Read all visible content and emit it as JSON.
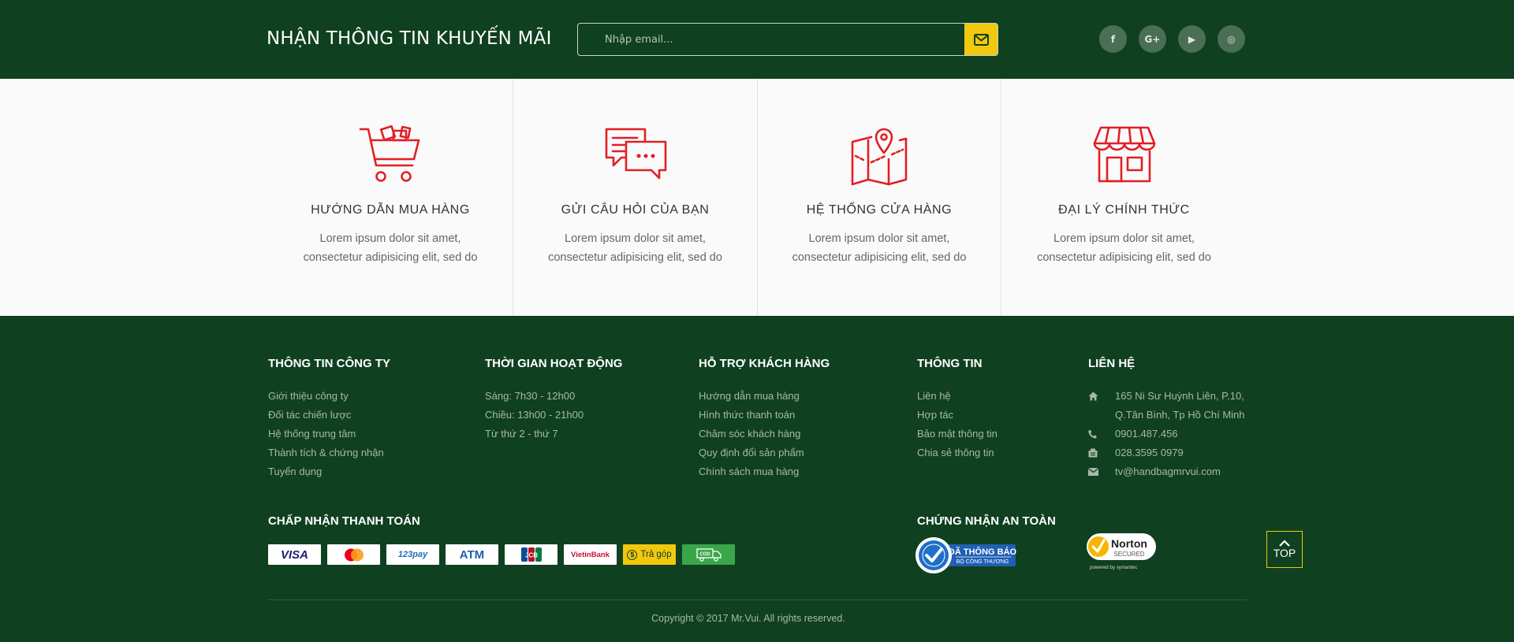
{
  "newsletter": {
    "title": "NHẬN THÔNG TIN KHUYẾN MÃI",
    "email_placeholder": "Nhập email...",
    "submit_icon": "envelope-icon",
    "socials": [
      {
        "name": "facebook",
        "glyph": "f"
      },
      {
        "name": "google-plus",
        "glyph": "G+"
      },
      {
        "name": "youtube",
        "glyph": "▶"
      },
      {
        "name": "instagram",
        "glyph": "◎"
      }
    ]
  },
  "services": [
    {
      "icon": "shopping-cart-icon",
      "title": "HƯỚNG DẪN MUA HÀNG",
      "desc_line1": "Lorem ipsum dolor sit amet,",
      "desc_line2": "consectetur adipisicing elit, sed do"
    },
    {
      "icon": "chat-bubbles-icon",
      "title": "GỬI CÂU HỎI CỦA BẠN",
      "desc_line1": "Lorem ipsum dolor sit amet,",
      "desc_line2": "consectetur adipisicing elit, sed do"
    },
    {
      "icon": "map-pin-icon",
      "title": "HỆ THỐNG CỬA HÀNG",
      "desc_line1": "Lorem ipsum dolor sit amet,",
      "desc_line2": "consectetur adipisicing elit, sed do"
    },
    {
      "icon": "store-icon",
      "title": "ĐẠI LÝ CHÍNH THỨC",
      "desc_line1": "Lorem ipsum dolor sit amet,",
      "desc_line2": "consectetur adipisicing elit, sed do"
    }
  ],
  "footer": {
    "company": {
      "title": "THÔNG TIN CÔNG TY",
      "items": [
        "Giới thiệu công ty",
        "Đối tác chiến lược",
        "Hệ thống trung tâm",
        "Thành tích & chứng nhận",
        "Tuyển dụng"
      ]
    },
    "hours": {
      "title": "THỜI GIAN HOẠT ĐỘNG",
      "items": [
        "Sáng: 7h30 - 12h00",
        "Chiều: 13h00 - 21h00",
        "Từ thứ 2 - thứ 7"
      ]
    },
    "support": {
      "title": "HỖ TRỢ KHÁCH HÀNG",
      "items": [
        "Hướng dẫn mua hàng",
        "Hình thức thanh toán",
        "Chăm sóc khách hàng",
        "Quy định đổi sản phẩm",
        "Chính sách mua hàng"
      ]
    },
    "info": {
      "title": "THÔNG TIN",
      "items": [
        "Liên hệ",
        "Hợp tác",
        "Bảo mật thông tin",
        "Chia sẻ thông tin"
      ]
    },
    "contact": {
      "title": "LIÊN HỆ",
      "address_line1": "165 Ni Sư Huỳnh Liên, P.10,",
      "address_line2": "Q.Tân Bình, Tp Hồ Chí Minh",
      "phone": "0901.487.456",
      "fax": "028.3595 0979",
      "email": "tv@handbagmrvui.com"
    },
    "payment": {
      "title": "CHẤP NHẬN THANH TOÁN",
      "methods": [
        "VISA",
        "Mastercard",
        "123pay",
        "ATM",
        "JCB",
        "VietinBank",
        "Trả góp",
        "COD"
      ]
    },
    "certification": {
      "title": "CHỨNG NHẬN AN TOÀN",
      "bct_line1": "ĐÃ THÔNG BÁO",
      "bct_line2": "BỘ CÔNG THƯƠNG",
      "norton_name": "Norton",
      "norton_sub": "SECURED",
      "norton_powered": "powered by symantec"
    },
    "top_button": "TOP",
    "copyright": "Copyright © 2017 Mr.Vui. All rights reserved."
  },
  "colors": {
    "dark_green": "#0f4020",
    "accent_yellow": "#f2c80f",
    "icon_red": "#e31e24",
    "service_bg": "#fafafa"
  }
}
